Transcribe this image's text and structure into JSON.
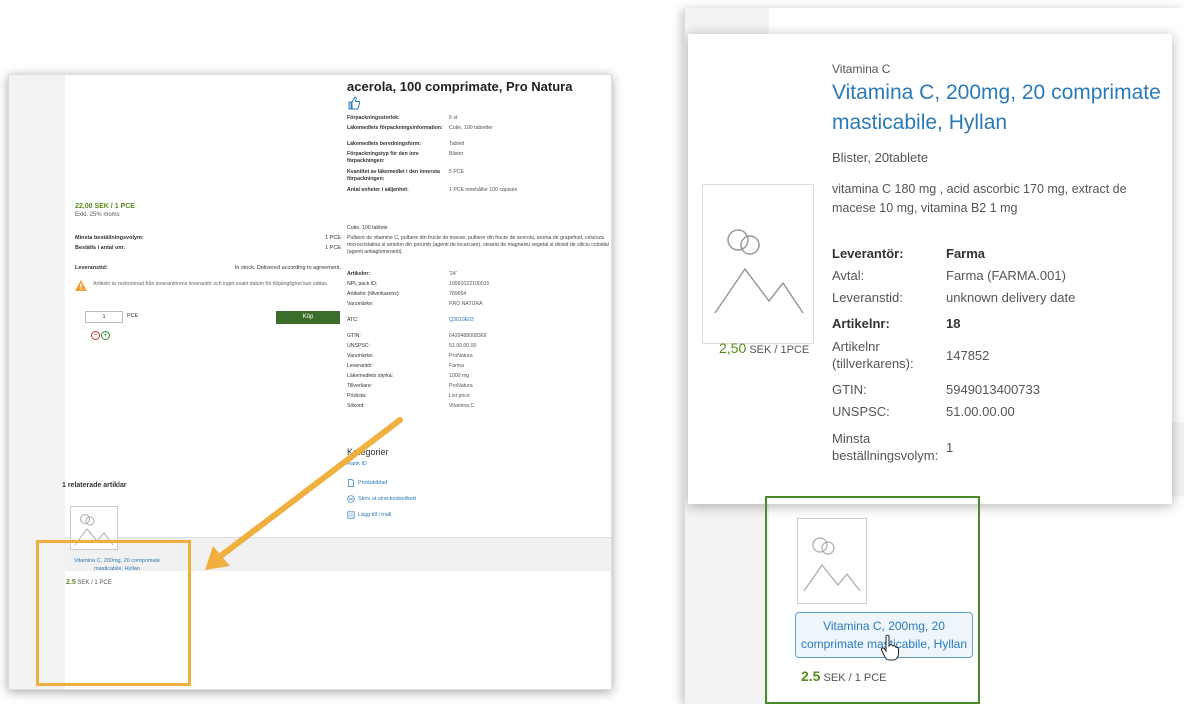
{
  "left": {
    "product_title": "acerola, 100 comprimate, Pro Natura",
    "price_main": "22,00 SEK / 1 PCE",
    "price_note": "Exkl. 25% moms",
    "order_rows": [
      {
        "label": "Minsta beställningsvolym:",
        "value": "1 PCE"
      },
      {
        "label": "Beställs i antal om:",
        "value": "1 PCE"
      },
      {
        "label": "Leveranstid:",
        "value": "In stock. Delivered according to agreement."
      }
    ],
    "warning_text": "Artikeln är restnoterad från leverantörens leverantör och inget exakt datum för tillgänglighet kan sättas.",
    "qty_value": "1",
    "qty_unit": "PCE",
    "buy_label": "Köp",
    "minus": "−",
    "plus": "+",
    "pack_specs": [
      {
        "k": "Förpackningsstorlek:",
        "v": "5 st"
      },
      {
        "k": "Läkemedlets förpackningsinformation:",
        "v": "Cutie, 100 tabletter"
      },
      {
        "k": "Läkemedlets beredningsform:",
        "v": "Tablett"
      },
      {
        "k": "Förpackningstyp för den inre förpackningen:",
        "v": "Blister"
      },
      {
        "k": "Kvantitet av läkemedlet i den innersta förpackningen:",
        "v": "5 PCE"
      },
      {
        "k": "Antal enheter i säljenhet:",
        "v": "1 PCE innehåller 100 capsule"
      }
    ],
    "desc_head": "Cutie, 100 tablete",
    "description": "Pulbere de vitamine C, pulbere din fructe de macee, pulbere din fructe de acerola, aroma de grapefruit, celuloza microcristalina si amidon din porumb (agenti de incarcare), stearat de magneziu vegetal si dioxid de siliciu coloidal (agenti antiaglomeranti).",
    "specs": [
      {
        "k": "Artikelnr:",
        "v": "'24'"
      },
      {
        "k": "NPL pack ID:",
        "v": "19991022100015"
      },
      {
        "k": "Artikelnr (tillverkarens):",
        "v": "789654"
      },
      {
        "k": "Varumärke:",
        "v": "PRO NATURA"
      },
      {
        "k": "ATC:",
        "v": "Q3010E03",
        "link": true
      },
      {
        "k": "GTIN:",
        "v": "6420488008369"
      },
      {
        "k": "UNSPSC:",
        "v": "51.00.00.00"
      },
      {
        "k": "Varumärke:",
        "v": "ProNatura"
      },
      {
        "k": "Leverantör:",
        "v": "Farma"
      },
      {
        "k": "Läkemedlets styrka:",
        "v": "1000 mg"
      },
      {
        "k": "Tillverkare:",
        "v": "ProNatura"
      },
      {
        "k": "Prislista:",
        "v": "List price"
      },
      {
        "k": "Sökord:",
        "v": "Vitamina C"
      }
    ],
    "categories_title": "Kategorier",
    "category_link": "Rank ID",
    "actions": [
      "Produktblad",
      "Skriv ut streckodsetikett",
      "Lägg till i mall"
    ],
    "related_label": "1 relaterade artiklar",
    "related_name": "Vitamina C, 200mg, 20 comprimate masticabile, Hyllan",
    "related_price_value": "2.5",
    "related_price_unit": "SEK / 1 PCE"
  },
  "right": {
    "brand": "Vitamina C",
    "title": "Vitamina C, 200mg, 20 comprimate masticabile, Hyllan",
    "pack": "Blister, 20tablete",
    "ingredients": "vitamina C 180 mg , acid ascorbic 170 mg, extract de macese 10 mg, vitamina B2 1 mg",
    "price_value": "2,50",
    "price_unit": "SEK / 1PCE",
    "details": [
      {
        "k": "Leverantör:",
        "v": "Farma",
        "bold": true
      },
      {
        "k": "Avtal:",
        "v": "Farma (FARMA.001)"
      },
      {
        "k": "Leveranstid:",
        "v": "unknown delivery date"
      },
      {
        "k": "Artikelnr:",
        "v": "18",
        "bold": true
      },
      {
        "k": "Artikelnr (tillverkarens):",
        "v": "147852"
      },
      {
        "k": "GTIN:",
        "v": "5949013400733"
      },
      {
        "k": "UNSPSC:",
        "v": "51.00.00.00"
      },
      {
        "k": "Minsta beställningsvolym:",
        "v": "1"
      }
    ],
    "tile_name": "Vitamina C, 200mg, 20 comprimate masticabile, Hyllan",
    "tile_price_value": "2.5",
    "tile_price_unit": "SEK / 1 PCE"
  },
  "colors": {
    "accent_link": "#2a7ab8",
    "price_green": "#5a8a1f",
    "buy_green": "#3a6e2a",
    "highlight_orange": "#f0b040",
    "highlight_green": "#4a8a2a"
  }
}
